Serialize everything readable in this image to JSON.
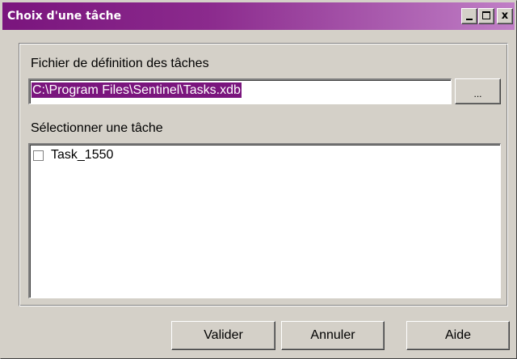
{
  "window": {
    "title": "Choix d'une tâche",
    "title_gradient_start": "#7a157d",
    "title_gradient_end": "#c07fc6",
    "controls": {
      "minimize_icon": "minimize-icon",
      "maximize_icon": "maximize-icon",
      "close_label": "x"
    }
  },
  "file": {
    "label": "Fichier de définition des tâches",
    "value": "C:\\Program Files\\Sentinel\\Tasks.xdb",
    "selection_color": "#7a157d",
    "browse_label": "..."
  },
  "tasks": {
    "label": "Sélectionner une tâche",
    "items": [
      {
        "label": "Task_1550",
        "checked": false
      }
    ]
  },
  "buttons": {
    "ok": "Valider",
    "cancel": "Annuler",
    "help": "Aide"
  }
}
